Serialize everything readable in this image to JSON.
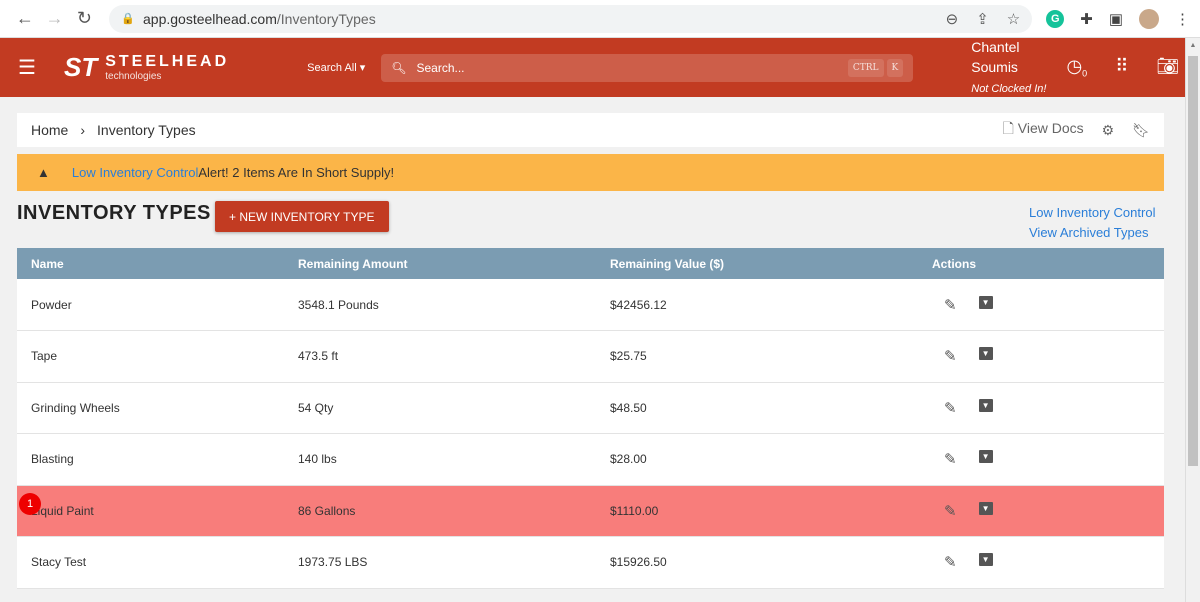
{
  "browser": {
    "url_host": "app.gosteelhead.com",
    "url_path": "/InventoryTypes"
  },
  "header": {
    "logo_name": "STEELHEAD",
    "logo_sub": "technologies",
    "search_scope": "Search All",
    "search_placeholder": "Search...",
    "kbd_ctrl": "CTRL",
    "kbd_k": "K",
    "user_first": "Chantel",
    "user_last": "Soumis",
    "clock_status": "Not Clocked In!",
    "clock_count": "0"
  },
  "breadcrumb": {
    "home": "Home",
    "current": "Inventory Types",
    "view_docs": "View Docs"
  },
  "alert": {
    "link": "Low Inventory Control",
    "text": " Alert! 2 Items Are In Short Supply!"
  },
  "page": {
    "title": "INVENTORY TYPES",
    "new_button": "+ NEW INVENTORY TYPE",
    "link_low": "Low Inventory Control",
    "link_archived": "View Archived Types"
  },
  "table": {
    "headers": [
      "Name",
      "Remaining Amount",
      "Remaining Value ($)",
      "Actions"
    ],
    "rows": [
      {
        "name": "Powder",
        "amount": "3548.1 Pounds",
        "value": "$42456.12"
      },
      {
        "name": "Tape",
        "amount": "473.5 ft",
        "value": "$25.75"
      },
      {
        "name": "Grinding Wheels",
        "amount": "54 Qty",
        "value": "$48.50"
      },
      {
        "name": "Blasting",
        "amount": "140 lbs",
        "value": "$28.00"
      },
      {
        "name": "Liquid Paint",
        "amount": "86 Gallons",
        "value": "$1110.00"
      },
      {
        "name": "Stacy Test",
        "amount": "1973.75 LBS",
        "value": "$15926.50"
      }
    ]
  },
  "step_badge": "1"
}
